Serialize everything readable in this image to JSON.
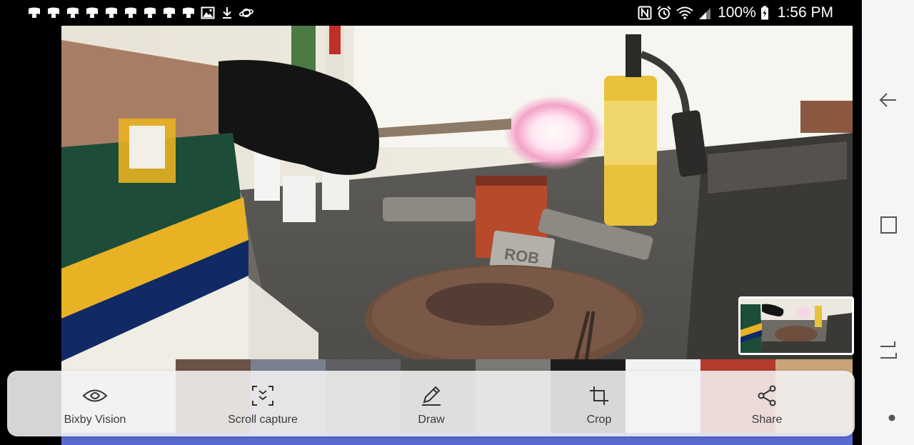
{
  "status_bar": {
    "battery": "100%",
    "time": "1:56 PM",
    "notification_icons": [
      "app-notification-icon",
      "app-notification-icon",
      "app-notification-icon",
      "app-notification-icon",
      "app-notification-icon",
      "app-notification-icon",
      "app-notification-icon",
      "app-notification-icon",
      "app-notification-icon",
      "image-icon",
      "download-icon",
      "saturn-icon"
    ],
    "status_icons": [
      "nfc-icon",
      "alarm-icon",
      "wifi-icon",
      "signal-icon",
      "battery-icon"
    ]
  },
  "video": {
    "plate_text": "ROB"
  },
  "toolbar": {
    "items": [
      {
        "label": "Bixby Vision",
        "icon": "eye-icon"
      },
      {
        "label": "Scroll capture",
        "icon": "scroll-capture-icon"
      },
      {
        "label": "Draw",
        "icon": "pencil-icon"
      },
      {
        "label": "Crop",
        "icon": "crop-icon"
      },
      {
        "label": "Share",
        "icon": "share-icon"
      }
    ]
  },
  "nav_bar": {
    "buttons": [
      "back-icon",
      "recents-icon",
      "home-icon",
      "nav-dot-icon"
    ]
  },
  "colors": {
    "status_bg": "#000000",
    "toolbar_bg": "#f2f2f2",
    "nav_bg": "#f5f5f5",
    "label_color": "#3a3a3a"
  }
}
